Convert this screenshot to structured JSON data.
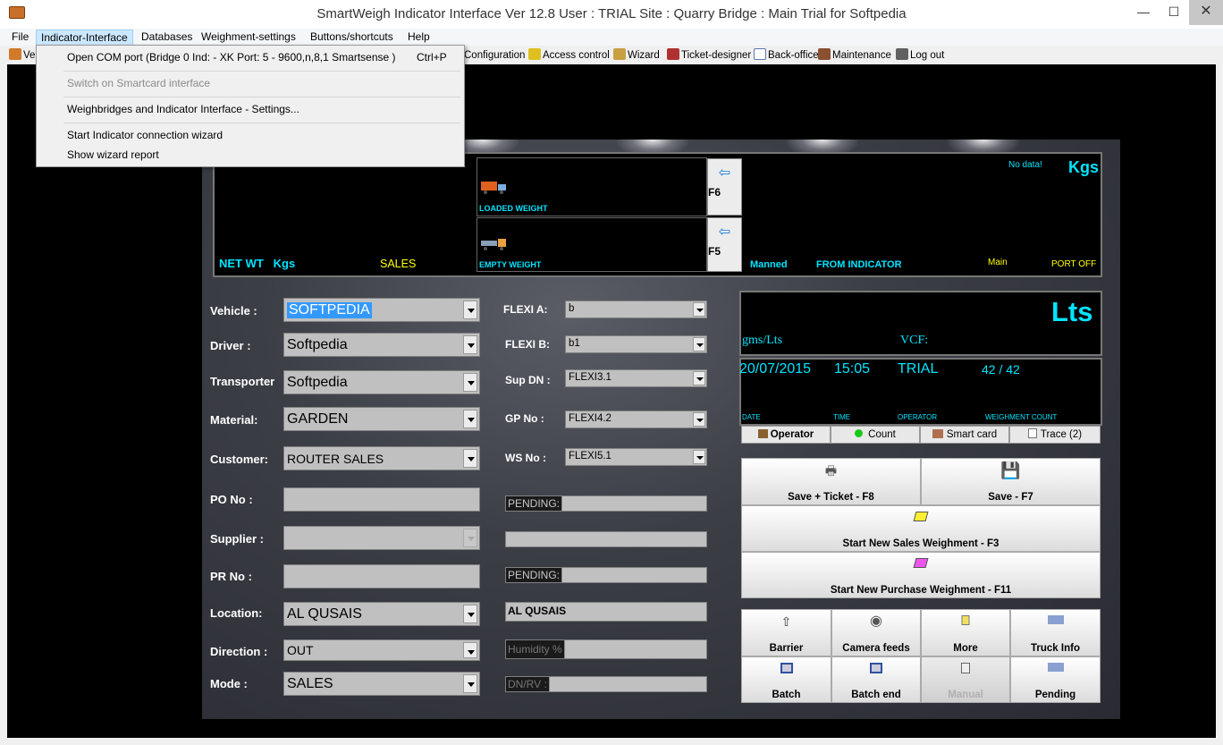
{
  "window": {
    "title": "SmartWeigh Indicator Interface Ver 12.8     User : TRIAL      Site : Quarry     Bridge : Main     Trial for Softpedia",
    "minimize": "—",
    "maximize": "☐",
    "close": "✕"
  },
  "menu": [
    "File",
    "Indicator-Interface",
    "Databases",
    "Weighment-settings",
    "Buttons/shortcuts",
    "Help"
  ],
  "toolbar": {
    "partial_first": "Ve",
    "items": [
      "Configuration",
      "Access control",
      "Wizard",
      "Ticket-designer",
      "Back-office",
      "Maintenance",
      "Log out"
    ]
  },
  "dropdown": {
    "open_com": "Open COM port (Bridge 0 Ind:   - XK Port: 5 - 9600,n,8,1 Smartsense )",
    "open_com_shortcut": "Ctrl+P",
    "smartcard": "Switch on Smartcard interface",
    "settings": "Weighbridges and Indicator Interface -  Settings...",
    "wizard": "Start Indicator connection wizard",
    "report": "Show wizard report"
  },
  "display": {
    "net_wt": "NET WT",
    "net_unit": "Kgs",
    "sales": "SALES",
    "loaded_weight": "LOADED WEIGHT",
    "empty_weight": "EMPTY WEIGHT",
    "f6": "F6",
    "f5": "F5",
    "no_data": "No data!",
    "kgs": "Kgs",
    "manned": "Manned",
    "from_indicator": "FROM INDICATOR",
    "main": "Main",
    "port_off": "PORT OFF"
  },
  "form": {
    "vehicle_label": "Vehicle   :",
    "vehicle": "SOFTPEDIA",
    "driver_label": "Driver     :",
    "driver": "Softpedia",
    "transporter_label": "Transporter",
    "transporter": "Softpedia",
    "material_label": "Material:",
    "material": "GARDEN",
    "customer_label": "Customer:",
    "customer": "ROUTER SALES",
    "po_label": "PO No     :",
    "supplier_label": "Supplier  :",
    "pr_label": "PR No     :",
    "location_label": "Location:",
    "location": "AL QUSAIS",
    "direction_label": "Direction :",
    "direction": "OUT",
    "mode_label": "Mode      :",
    "mode": "SALES"
  },
  "flexi": {
    "a_label": "FLEXI A:",
    "a": "b",
    "b_label": "FLEXI B:",
    "b": "b1",
    "sup_label": "Sup DN :",
    "sup": "FLEXI3.1",
    "gp_label": "GP No  :",
    "gp": "FLEXI4.2",
    "ws_label": "WS No  :",
    "ws": "FLEXI5.1",
    "pending1": "PENDING:",
    "pending2": "PENDING:",
    "location_text": "AL QUSAIS",
    "humidity": "Humidity %",
    "dnrv": "DN/RV  :"
  },
  "right": {
    "lts": "Lts",
    "gms": "gms/Lts",
    "vcf": "VCF:",
    "date": "20/07/2015",
    "time": "15:05",
    "operator": "TRIAL",
    "count": "42 / 42",
    "date_l": "DATE",
    "time_l": "TIME",
    "operator_l": "OPERATOR",
    "count_l": "WEIGHMENT COUNT"
  },
  "tabs": [
    "Operator",
    "Count",
    "Smart card",
    "Trace (2)"
  ],
  "buttons": {
    "save_ticket": "Save + Ticket - F8",
    "save": "Save - F7",
    "new_sales": "Start New Sales Weighment - F3",
    "new_purchase": "Start New Purchase Weighment - F11",
    "barrier": "Barrier",
    "camera": "Camera feeds",
    "more": "More",
    "truck_info": "Truck Info",
    "batch": "Batch",
    "batch_end": "Batch end",
    "manual": "Manual",
    "pending": "Pending"
  },
  "colors": {
    "display_cyan": "#00e5ff",
    "display_yellow": "#ffff00",
    "selection_blue": "#3399ff"
  }
}
